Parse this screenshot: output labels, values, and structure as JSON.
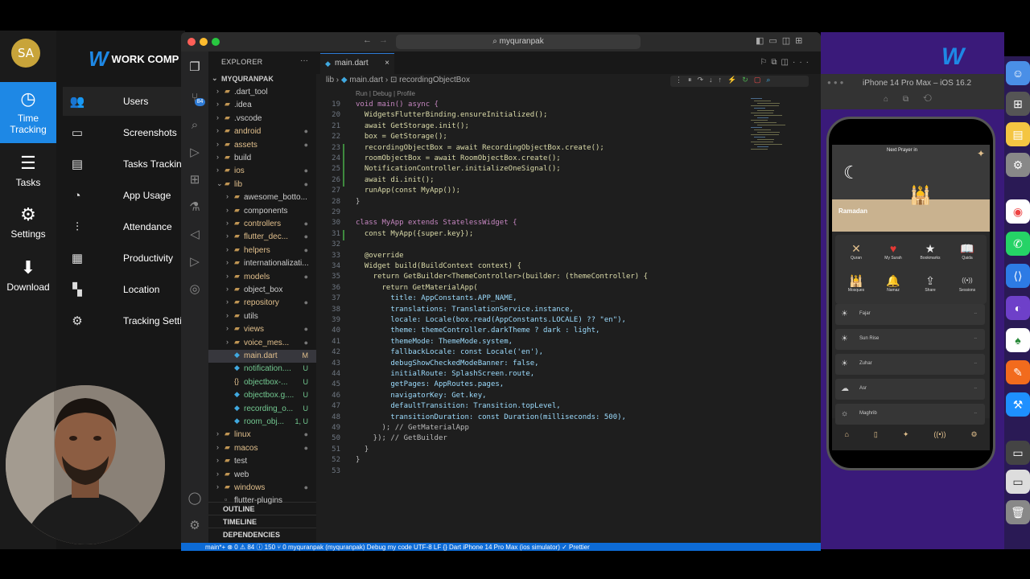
{
  "app": {
    "avatar_initials": "SA",
    "brand": "WORK COMP",
    "rail": [
      {
        "label": "Time\nTracking",
        "icon": "clock-icon"
      },
      {
        "label": "Tasks",
        "icon": "list-icon"
      },
      {
        "label": "Settings",
        "icon": "gear-icon"
      },
      {
        "label": "Download",
        "icon": "download-icon"
      }
    ],
    "menu": [
      {
        "label": "Users",
        "icon": "users-icon"
      },
      {
        "label": "Screenshots",
        "icon": "monitor-icon"
      },
      {
        "label": "Tasks Trackin",
        "icon": "list-icon"
      },
      {
        "label": "App Usage",
        "icon": "pie-icon"
      },
      {
        "label": "Attendance",
        "icon": "sliders-icon"
      },
      {
        "label": "Productivity",
        "icon": "document-icon"
      },
      {
        "label": "Location",
        "icon": "map-icon"
      },
      {
        "label": "Tracking Setti",
        "icon": "gear-icon"
      }
    ]
  },
  "vscode": {
    "search": "myquranpak",
    "explorer_title": "EXPLORER",
    "root": "MYQURANPAK",
    "tree": [
      {
        "name": ".dart_tool",
        "type": "folder",
        "level": 1,
        "status": ""
      },
      {
        "name": ".idea",
        "type": "folder",
        "level": 1,
        "status": ""
      },
      {
        "name": ".vscode",
        "type": "folder",
        "level": 1,
        "status": ""
      },
      {
        "name": "android",
        "type": "folder",
        "level": 1,
        "status": "●"
      },
      {
        "name": "assets",
        "type": "folder",
        "level": 1,
        "status": "●"
      },
      {
        "name": "build",
        "type": "folder",
        "level": 1,
        "status": ""
      },
      {
        "name": "ios",
        "type": "folder",
        "level": 1,
        "status": "●"
      },
      {
        "name": "lib",
        "type": "folder-open",
        "level": 1,
        "status": "●"
      },
      {
        "name": "awesome_botto...",
        "type": "folder",
        "level": 2,
        "status": ""
      },
      {
        "name": "components",
        "type": "folder",
        "level": 2,
        "status": ""
      },
      {
        "name": "controllers",
        "type": "folder",
        "level": 2,
        "status": "●"
      },
      {
        "name": "flutter_dec...",
        "type": "folder",
        "level": 2,
        "status": "●"
      },
      {
        "name": "helpers",
        "type": "folder",
        "level": 2,
        "status": "●"
      },
      {
        "name": "internationalizati...",
        "type": "folder",
        "level": 2,
        "status": ""
      },
      {
        "name": "models",
        "type": "folder",
        "level": 2,
        "status": "●"
      },
      {
        "name": "object_box",
        "type": "folder",
        "level": 2,
        "status": ""
      },
      {
        "name": "repository",
        "type": "folder",
        "level": 2,
        "status": "●"
      },
      {
        "name": "utils",
        "type": "folder",
        "level": 2,
        "status": ""
      },
      {
        "name": "views",
        "type": "folder",
        "level": 2,
        "status": "●"
      },
      {
        "name": "voice_mes...",
        "type": "folder",
        "level": 2,
        "status": "●"
      },
      {
        "name": "main.dart",
        "type": "dart",
        "level": 2,
        "status": "M"
      },
      {
        "name": "notification....",
        "type": "dart",
        "level": 2,
        "status": "U"
      },
      {
        "name": "objectbox-...",
        "type": "json",
        "level": 2,
        "status": "U"
      },
      {
        "name": "objectbox.g....",
        "type": "dart",
        "level": 2,
        "status": "U"
      },
      {
        "name": "recording_o...",
        "type": "dart",
        "level": 2,
        "status": "U"
      },
      {
        "name": "room_obj...",
        "type": "dart",
        "level": 2,
        "status": "1, U"
      },
      {
        "name": "linux",
        "type": "folder",
        "level": 1,
        "status": "●"
      },
      {
        "name": "macos",
        "type": "folder",
        "level": 1,
        "status": "●"
      },
      {
        "name": "test",
        "type": "folder",
        "level": 1,
        "status": ""
      },
      {
        "name": "web",
        "type": "folder",
        "level": 1,
        "status": ""
      },
      {
        "name": "windows",
        "type": "folder",
        "level": 1,
        "status": "●"
      },
      {
        "name": "flutter-plugins",
        "type": "file",
        "level": 1,
        "status": ""
      }
    ],
    "sections": [
      "OUTLINE",
      "TIMELINE",
      "DEPENDENCIES"
    ],
    "tab_label": "main.dart",
    "breadcrumb": [
      "lib",
      "main.dart",
      "recordingObjectBox"
    ],
    "codelens": "Run | Debug | Profile",
    "code": [
      {
        "n": 19,
        "t": "void main() async {"
      },
      {
        "n": 20,
        "t": "  WidgetsFlutterBinding.ensureInitialized();"
      },
      {
        "n": 21,
        "t": "  await GetStorage.init();"
      },
      {
        "n": 22,
        "t": "  box = GetStorage();"
      },
      {
        "n": 23,
        "t": "  recordingObjectBox = await RecordingObjectBox.create();"
      },
      {
        "n": 24,
        "t": "  roomObjectBox = await RoomObjectBox.create();"
      },
      {
        "n": 25,
        "t": "  NotificationController.initializeOneSignal();"
      },
      {
        "n": 26,
        "t": "  await di.init();"
      },
      {
        "n": 27,
        "t": "  runApp(const MyApp());"
      },
      {
        "n": 28,
        "t": "}"
      },
      {
        "n": 29,
        "t": ""
      },
      {
        "n": 30,
        "t": "class MyApp extends StatelessWidget {"
      },
      {
        "n": 31,
        "t": "  const MyApp({super.key});"
      },
      {
        "n": 32,
        "t": ""
      },
      {
        "n": 33,
        "t": "  @override"
      },
      {
        "n": 34,
        "t": "  Widget build(BuildContext context) {"
      },
      {
        "n": 35,
        "t": "    return GetBuilder<ThemeController>(builder: (themeController) {"
      },
      {
        "n": 36,
        "t": "      return GetMaterialApp("
      },
      {
        "n": 37,
        "t": "        title: AppConstants.APP_NAME,"
      },
      {
        "n": 38,
        "t": "        translations: TranslationService.instance,"
      },
      {
        "n": 39,
        "t": "        locale: Locale(box.read(AppConstants.LOCALE) ?? \"en\"),"
      },
      {
        "n": 40,
        "t": "        theme: themeController.darkTheme ? dark : light,"
      },
      {
        "n": 41,
        "t": "        themeMode: ThemeMode.system,"
      },
      {
        "n": 42,
        "t": "        fallbackLocale: const Locale('en'),"
      },
      {
        "n": 43,
        "t": "        debugShowCheckedModeBanner: false,"
      },
      {
        "n": 44,
        "t": "        initialRoute: SplashScreen.route,"
      },
      {
        "n": 45,
        "t": "        getPages: AppRoutes.pages,"
      },
      {
        "n": 46,
        "t": "        navigatorKey: Get.key,"
      },
      {
        "n": 47,
        "t": "        defaultTransition: Transition.topLevel,"
      },
      {
        "n": 48,
        "t": "        transitionDuration: const Duration(milliseconds: 500),"
      },
      {
        "n": 49,
        "t": "      ); // GetMaterialApp"
      },
      {
        "n": 50,
        "t": "    }); // GetBuilder"
      },
      {
        "n": 51,
        "t": "  }"
      },
      {
        "n": 52,
        "t": "}"
      },
      {
        "n": 53,
        "t": ""
      }
    ],
    "status": "main*+   ⊗ 0 ⚠ 84 ⓘ 150    ⑂ 0    myquranpak (myquranpak)    Debug my code         UTF-8    LF    {} Dart    iPhone 14 Pro Max (ios simulator)    ✓ Prettier"
  },
  "simulator": {
    "title": "iPhone 14 Pro Max – iOS 16.2",
    "next_prayer": "Next Prayer in",
    "ramadan": "Ramadan",
    "grid": [
      {
        "label": "Quran",
        "icon": "book-open-icon"
      },
      {
        "label": "My Surah",
        "icon": "heart-icon"
      },
      {
        "label": "Bookmarks",
        "icon": "star-icon"
      },
      {
        "label": "Qaida",
        "icon": "book-icon"
      },
      {
        "label": "Mosques",
        "icon": "mosque-icon"
      },
      {
        "label": "Namaz",
        "icon": "bell-icon"
      },
      {
        "label": "Share",
        "icon": "share-icon"
      },
      {
        "label": "Sessions",
        "icon": "broadcast-icon"
      }
    ],
    "prayers": [
      {
        "name": "Fajar",
        "icon": "sunrise-icon"
      },
      {
        "name": "Sun Rise",
        "icon": "sun-icon"
      },
      {
        "name": "Zuhar",
        "icon": "sun-icon"
      },
      {
        "name": "Asr",
        "icon": "cloud-icon"
      },
      {
        "name": "Maghrib",
        "icon": "sunset-icon"
      }
    ],
    "tabbar": [
      "⌂",
      "▯",
      "✦",
      "((•))",
      "⚙"
    ]
  },
  "colors": {
    "accent": "#1e88e5",
    "status_bar": "#0d6bd6",
    "dart_modified": "#e2c08d",
    "untracked": "#73c991"
  }
}
